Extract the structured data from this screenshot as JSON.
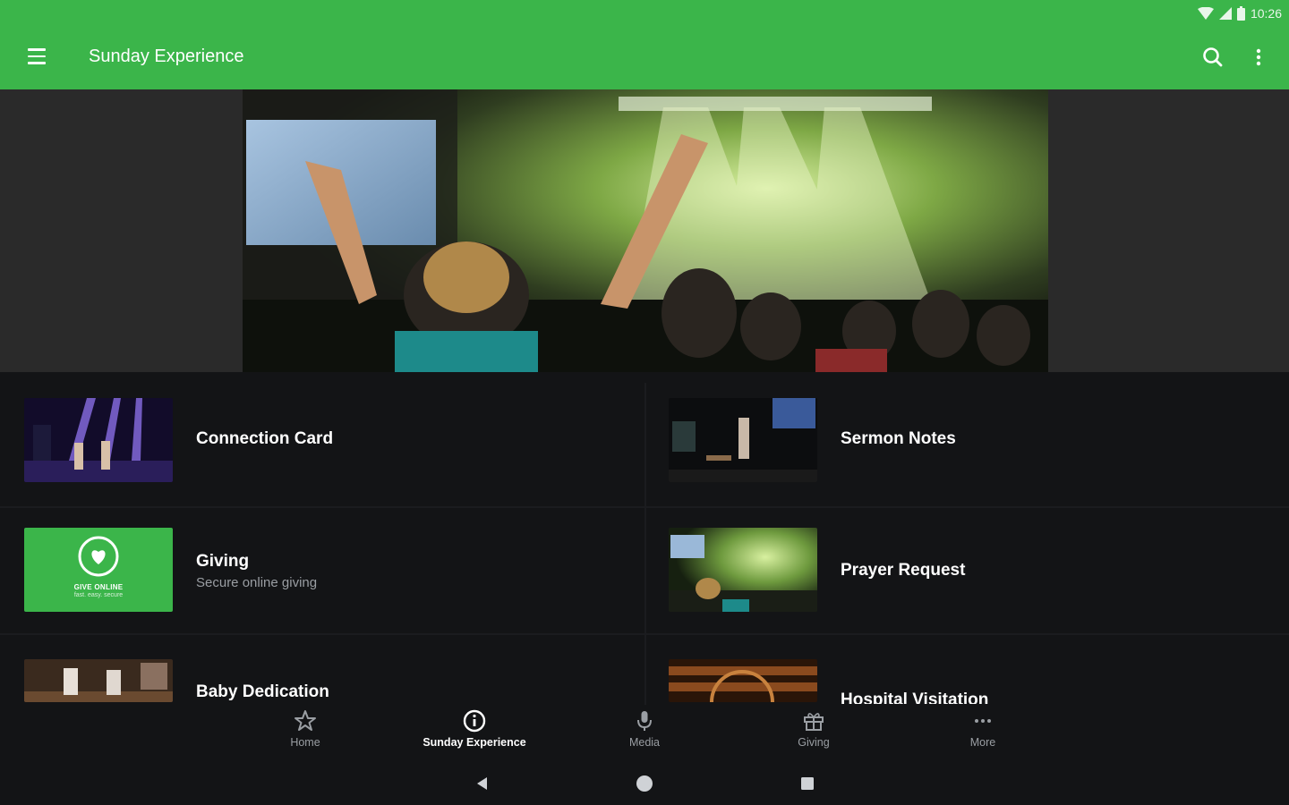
{
  "status": {
    "time": "10:26"
  },
  "appbar": {
    "title": "Sunday Experience"
  },
  "colors": {
    "brand": "#3bb54a",
    "background": "#131416",
    "muted_text": "#9a9ea3"
  },
  "icons": {
    "menu": "menu-icon",
    "search": "search-icon",
    "more": "more-vertical-icon",
    "home": "star-icon",
    "sunday": "info-icon",
    "media": "microphone-icon",
    "giving": "gift-icon",
    "more_tab": "more-horizontal-icon"
  },
  "items": [
    {
      "title": "Connection Card",
      "subtitle": ""
    },
    {
      "title": "Sermon Notes",
      "subtitle": ""
    },
    {
      "title": "Giving",
      "subtitle": "Secure online giving",
      "thumb_line1": "GIVE ONLINE",
      "thumb_line2": "fast. easy. secure"
    },
    {
      "title": "Prayer Request",
      "subtitle": ""
    },
    {
      "title": "Baby Dedication",
      "subtitle": ""
    },
    {
      "title": "Hospital Visitation",
      "subtitle": ""
    }
  ],
  "bottom_nav": [
    {
      "label": "Home",
      "active": false
    },
    {
      "label": "Sunday Experience",
      "active": true
    },
    {
      "label": "Media",
      "active": false
    },
    {
      "label": "Giving",
      "active": false
    },
    {
      "label": "More",
      "active": false
    }
  ]
}
